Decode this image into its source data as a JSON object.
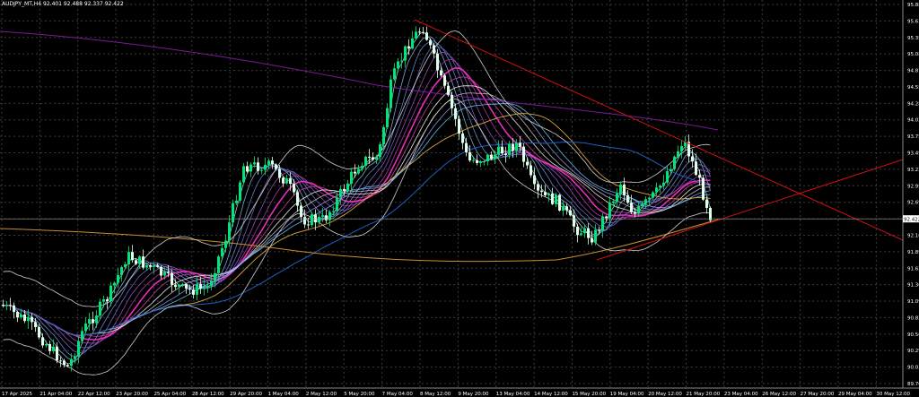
{
  "window": {
    "title": "AUDJPY_MT,H4 92.401 92.488 92.337 92.422"
  },
  "price_scale": {
    "labels": [
      "95.880",
      "95.615",
      "95.350",
      "95.080",
      "94.815",
      "94.550",
      "94.285",
      "94.020",
      "93.755",
      "93.490",
      "93.220",
      "92.955",
      "92.690",
      "92.422",
      "92.160",
      "91.890",
      "91.625",
      "91.360",
      "91.095",
      "90.830",
      "90.560",
      "90.295",
      "90.030",
      "89.765"
    ],
    "current_price": "92.422"
  },
  "time_scale": {
    "labels": [
      "17 Apr 2025",
      "21 Apr 04:00",
      "22 Apr 12:00",
      "23 Apr 20:00",
      "25 Apr 04:00",
      "28 Apr 12:00",
      "29 Apr 20:00",
      "1 May 04:00",
      "2 May 12:00",
      "5 May 20:00",
      "7 May 04:00",
      "8 May 12:00",
      "9 May 20:00",
      "13 May 04:00",
      "14 May 12:00",
      "15 May 20:00",
      "19 May 04:00",
      "20 May 12:00",
      "21 May 20:00",
      "23 May 04:00",
      "26 May 12:00",
      "27 May 20:00",
      "29 May 04:00",
      "30 May 12:00"
    ]
  },
  "colors": {
    "background": "#000000",
    "grid": "#3a3a3a",
    "candle_bull": "#00e676",
    "candle_bear": "#e0ffe8",
    "trendline": "#d01010",
    "bollinger": "#cfcfcf",
    "ma_long": "#d9a441",
    "ma_blue": "#1f5fc4",
    "ma_purple": "#7a1a9a",
    "ribbon_pink": "#ff33cc",
    "ribbon_light": "#a8d8ff"
  },
  "chart_data": {
    "type": "candlestick",
    "symbol": "AUDJPY_MT",
    "timeframe": "H4",
    "ohlc": {
      "open": 92.401,
      "high": 92.488,
      "low": 92.337,
      "close": 92.422
    },
    "ylim": [
      89.765,
      95.88
    ],
    "ma_ribbon_count": 12
  }
}
